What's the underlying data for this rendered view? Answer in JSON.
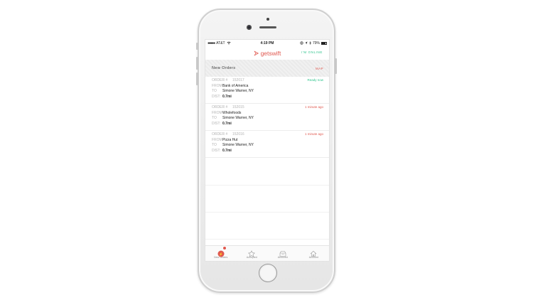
{
  "status_bar": {
    "carrier": "AT&T",
    "time": "4:19 PM",
    "battery_percent": "79%",
    "battery_level": 0.79
  },
  "header": {
    "app_name": "getswift",
    "online_status": "I'M ONLINE"
  },
  "section": {
    "title": "New Orders",
    "map_label": "MAP"
  },
  "orders": [
    {
      "order_label": "ORDER #",
      "order_number": "152017",
      "status": "Ready now",
      "from_label": "FROM",
      "from": "Bank of America",
      "to_label": "TO",
      "to": "Simone Warner, NY",
      "dist_label": "DIST:",
      "dist": "0.7mi"
    },
    {
      "order_label": "ORDER #",
      "order_number": "152015",
      "status": "1 minute ago",
      "from_label": "FROM",
      "from": "Wholefoods",
      "to_label": "TO",
      "to": "Simone Warner, NY",
      "dist_label": "DIST:",
      "dist": "0.7mi"
    },
    {
      "order_label": "ORDER #",
      "order_number": "152016",
      "status": "1 minute ago",
      "from_label": "FROM",
      "from": "Pizza Hut",
      "to_label": "TO",
      "to": "Simone Warner, NY",
      "dist_label": "DIST:",
      "dist": "0.7mi"
    }
  ],
  "tabs": [
    {
      "label": "New Orders",
      "icon": "orders-icon",
      "badge": "3"
    },
    {
      "label": "Accepted",
      "icon": "star-icon"
    },
    {
      "label": "Archived",
      "icon": "archive-icon"
    },
    {
      "label": "Account",
      "icon": "home-icon"
    }
  ],
  "colors": {
    "brand": "#e0584f",
    "online": "#2fc48d",
    "status_ready": "#2fc48d",
    "status_time": "#e0584f"
  }
}
